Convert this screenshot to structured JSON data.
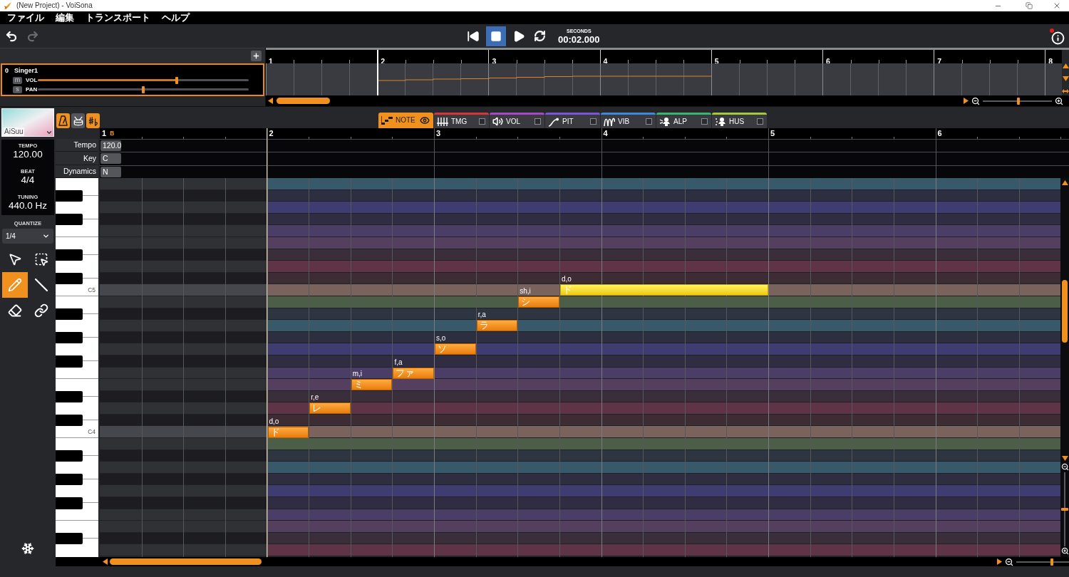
{
  "window": {
    "title": "(New Project) - VoiSona"
  },
  "menu": [
    "ファイル",
    "編集",
    "トランスポート",
    "ヘルプ"
  ],
  "toolbar": {
    "undo": {
      "disabled": false
    },
    "redo": {
      "disabled": true
    }
  },
  "transport": {
    "buttons": [
      {
        "kind": "start",
        "active": false
      },
      {
        "kind": "stop",
        "active": true
      },
      {
        "kind": "play",
        "active": false
      },
      {
        "kind": "loop",
        "active": false
      }
    ],
    "time_label": "SECONDS",
    "time": "00:02.000"
  },
  "info": {
    "badge": true
  },
  "tracks": [
    {
      "number": "0",
      "name": "Singer1",
      "selected": true,
      "mute": {
        "label": "m",
        "on": false
      },
      "solo": {
        "label": "s",
        "on": false
      },
      "sliders": [
        {
          "kind": "volume",
          "label": "VOL",
          "level": 0.66
        },
        {
          "kind": "pan",
          "label": "PAN",
          "level": 0.5
        }
      ]
    }
  ],
  "overview": {
    "bars": [
      "1",
      "2",
      "3",
      "4",
      "5",
      "6",
      "7",
      "8"
    ],
    "zoom": {
      "level": 0.52
    }
  },
  "singer": {
    "name": "AiSuu"
  },
  "song_info": [
    {
      "label": "TEMPO",
      "value": "120.00"
    },
    {
      "label": "BEAT",
      "value": "4/4"
    },
    {
      "label": "TUNING",
      "value": "440.0 Hz"
    }
  ],
  "quantize": {
    "label": "QUANTIZE",
    "value": "1/4"
  },
  "tools": [
    {
      "kind": "select",
      "selected": false
    },
    {
      "kind": "marquee",
      "selected": false
    },
    {
      "kind": "pencil",
      "selected": true
    },
    {
      "kind": "line",
      "selected": false
    },
    {
      "kind": "eraser",
      "selected": false
    },
    {
      "kind": "link",
      "selected": false
    }
  ],
  "mode_buttons": [
    {
      "kind": "metronome",
      "on": true
    },
    {
      "kind": "drum",
      "on": false
    },
    {
      "kind": "accidental",
      "on": true
    }
  ],
  "parameter_tabs": [
    {
      "kind": "note",
      "label": "NOTE",
      "selected": true
    },
    {
      "kind": "timing",
      "label": "TMG",
      "selected": false,
      "checked": false,
      "color": "#d8343c"
    },
    {
      "kind": "volume",
      "label": "VOL",
      "selected": false,
      "checked": false,
      "color": "#a648c4"
    },
    {
      "kind": "pitch",
      "label": "PIT",
      "selected": false,
      "checked": false,
      "color": "#7b55d8"
    },
    {
      "kind": "vibrato",
      "label": "VIB",
      "selected": false,
      "checked": false,
      "color": "#3f88d8"
    },
    {
      "kind": "alpha",
      "label": "ALP",
      "selected": false,
      "checked": false,
      "color": "#3bb46c"
    },
    {
      "kind": "husky",
      "label": "HUS",
      "selected": false,
      "checked": false,
      "color": "#a4c83c"
    }
  ],
  "ruler": {
    "bars": [
      {
        "label": "1",
        "marker": "B"
      },
      {
        "label": "2"
      },
      {
        "label": "3"
      },
      {
        "label": "4"
      },
      {
        "label": "5"
      },
      {
        "label": "6"
      }
    ]
  },
  "conductor_rows": [
    {
      "label": "Tempo",
      "value": "120.0"
    },
    {
      "label": "Key",
      "value": "C"
    },
    {
      "label": "Dynamics",
      "value": "N"
    }
  ],
  "piano": {
    "octave_labels": [
      "C5",
      "C4"
    ]
  },
  "notes": [
    {
      "phoneme": "d,o",
      "lyric": "ド",
      "selected": false
    },
    {
      "phoneme": "r,e",
      "lyric": "レ",
      "selected": false
    },
    {
      "phoneme": "m,i",
      "lyric": "ミ",
      "selected": false
    },
    {
      "phoneme": "f,a",
      "lyric": "ファ",
      "selected": false
    },
    {
      "phoneme": "s,o",
      "lyric": "ソ",
      "selected": false
    },
    {
      "phoneme": "r,a",
      "lyric": "ラ",
      "selected": false
    },
    {
      "phoneme": "sh,i",
      "lyric": "シ",
      "selected": false
    },
    {
      "phoneme": "d,o",
      "lyric": "ド",
      "selected": true
    }
  ],
  "editor_zoom": {
    "horizontal": {
      "level": 0.52
    },
    "vertical": {
      "level": 0.5
    }
  }
}
